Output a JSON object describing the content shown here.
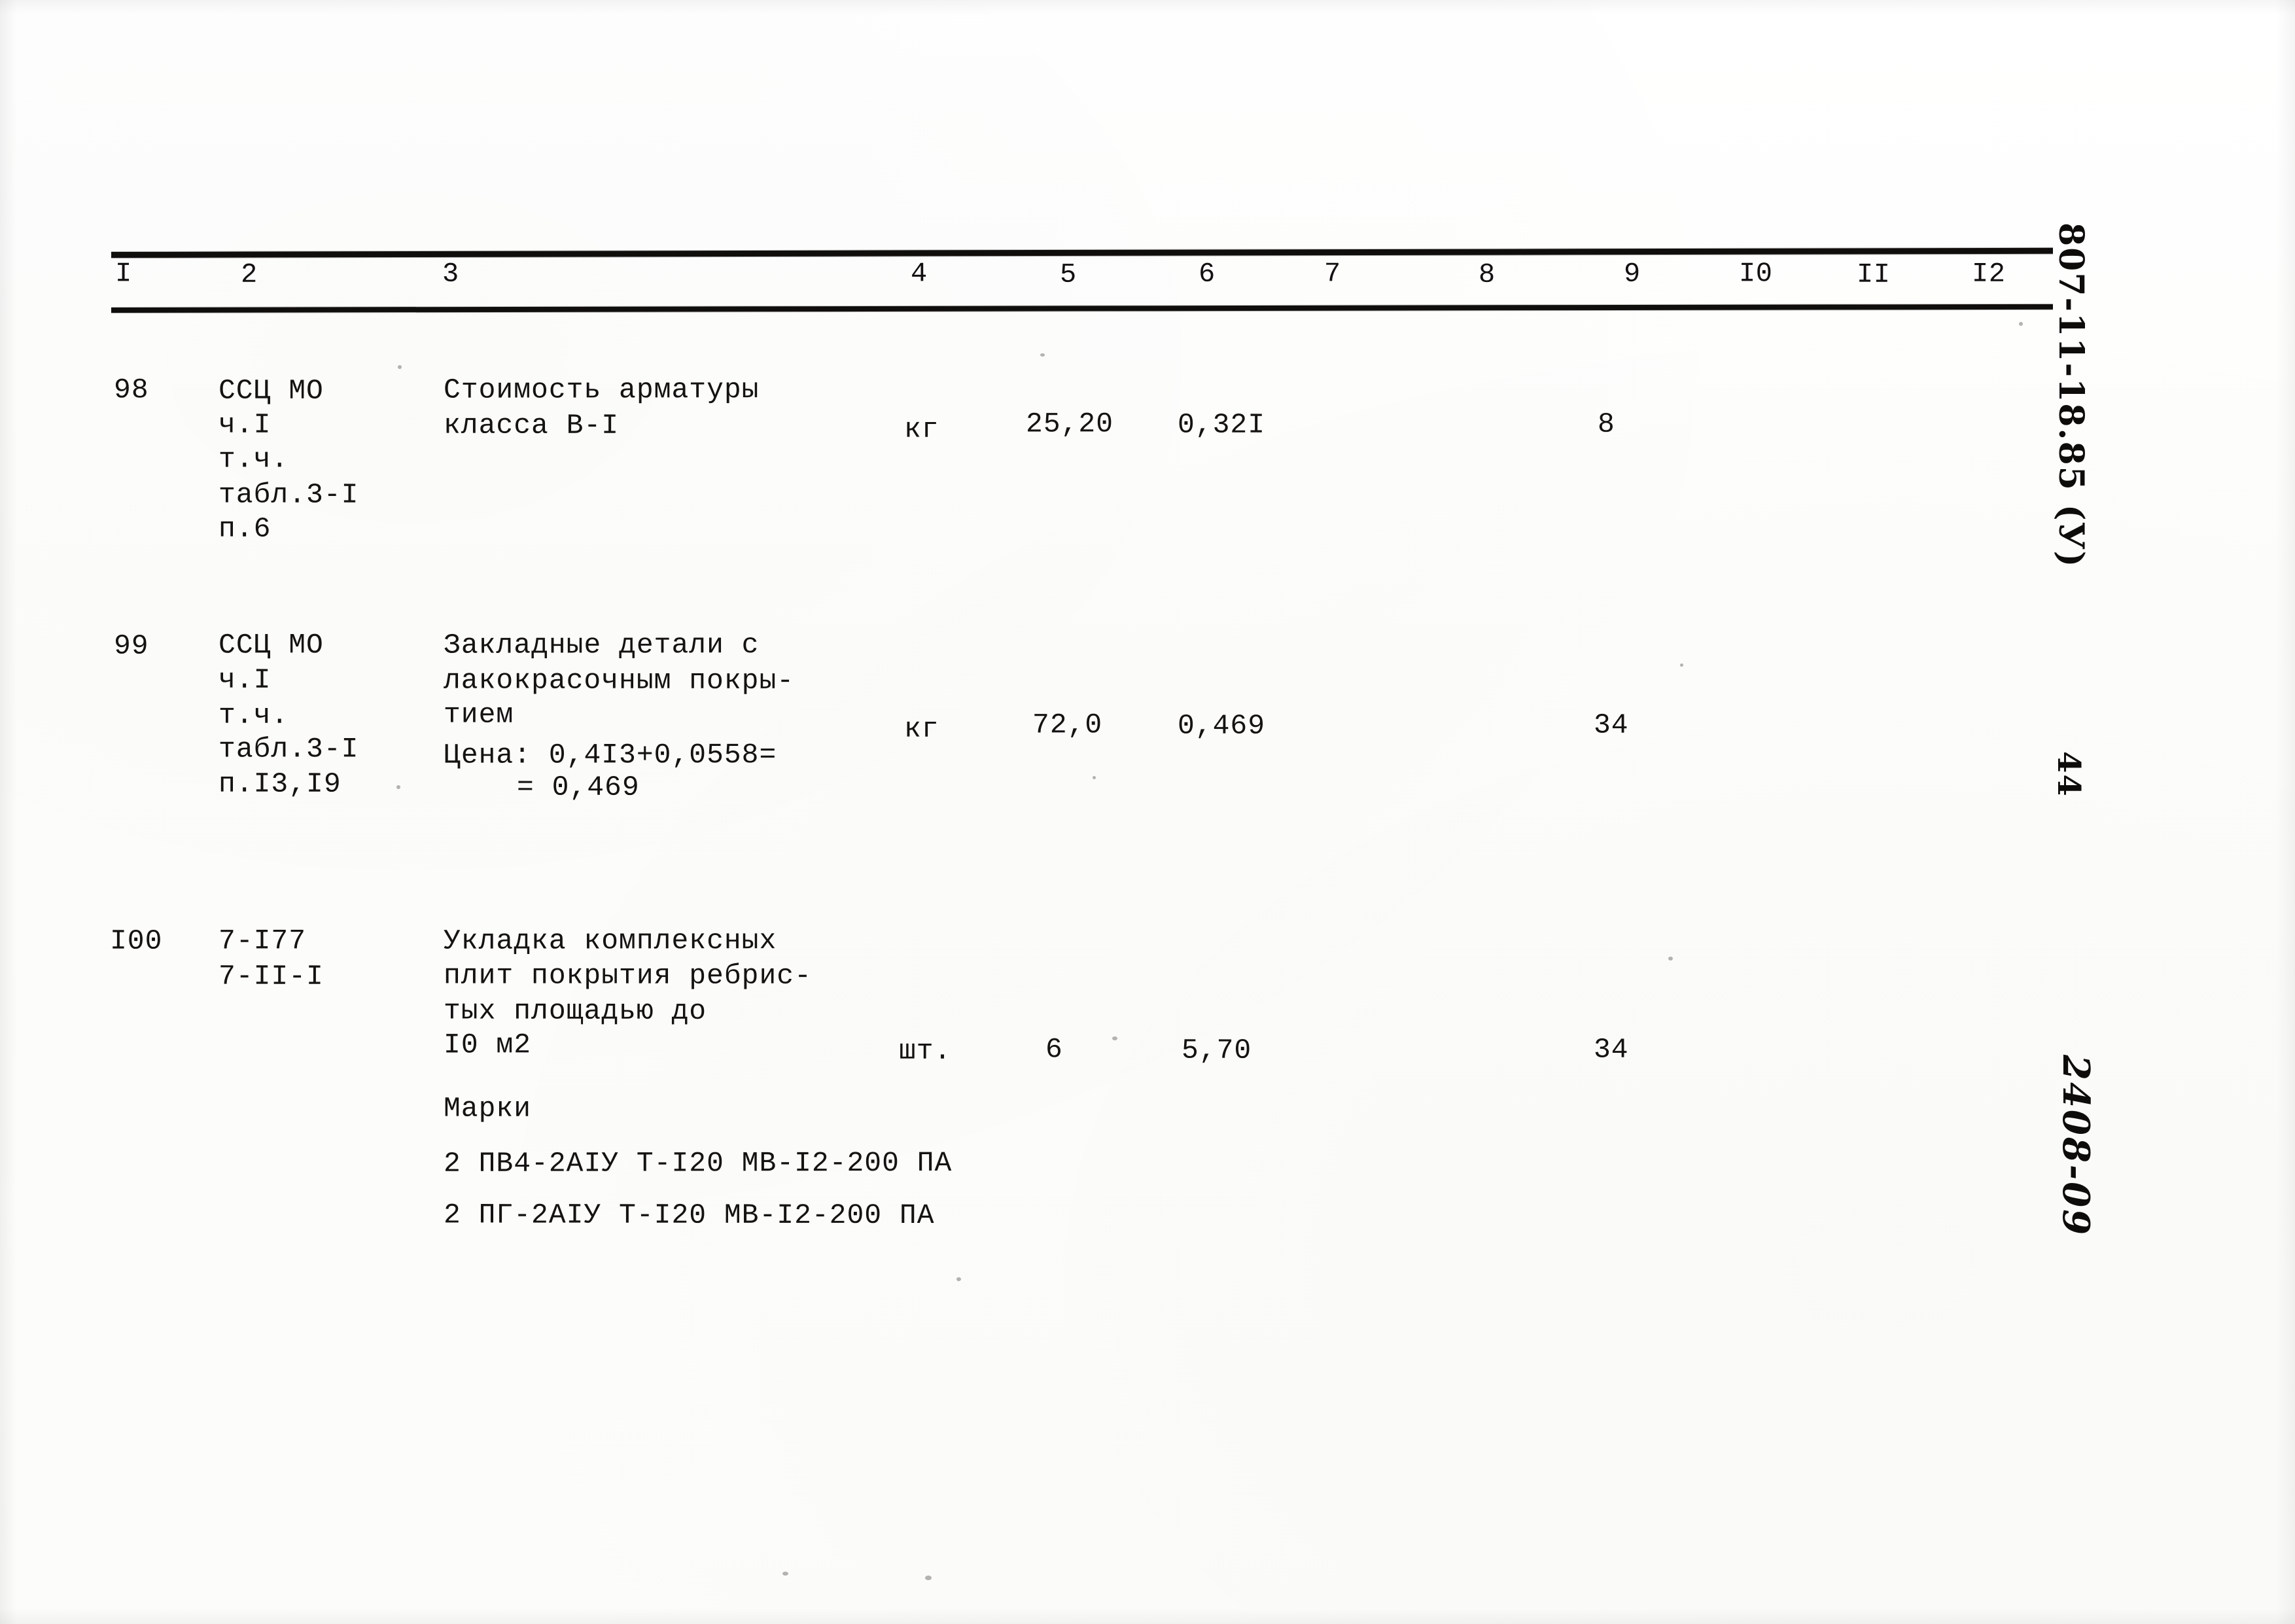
{
  "document": {
    "type": "estimate-table-page",
    "column_headers": [
      "I",
      "2",
      "3",
      "4",
      "5",
      "6",
      "7",
      "8",
      "9",
      "I0",
      "II",
      "I2"
    ],
    "rows": [
      {
        "no": "98",
        "justification_lines": [
          "ССЦ МО",
          "ч.I",
          "т.ч.",
          "табл.3-I",
          "п.6"
        ],
        "description_lines": [
          "Стоимость арматуры",
          "класса В-I"
        ],
        "unit": "кг",
        "col5": "25,20",
        "col6": "0,32I",
        "col7": "",
        "col8": "",
        "col9": "8",
        "col10": "",
        "col11": "",
        "col12": ""
      },
      {
        "no": "99",
        "justification_lines": [
          "ССЦ МО",
          "ч.I",
          "т.ч.",
          "табл.3-I",
          "п.I3,I9"
        ],
        "description_lines": [
          "Закладные детали с",
          "лакокрасочным покры-",
          "тием"
        ],
        "price_note_line1": "Цена: 0,4I3+0,0558=",
        "price_note_line2": "= 0,469",
        "unit": "кг",
        "col5": "72,0",
        "col6": "0,469",
        "col7": "",
        "col8": "",
        "col9": "34",
        "col10": "",
        "col11": "",
        "col12": ""
      },
      {
        "no": "I00",
        "justification_lines": [
          "7-I77",
          "7-II-I"
        ],
        "description_lines": [
          "Укладка комплексных",
          "плит покрытия ребрис-",
          "тых площадью до",
          "I0 м2"
        ],
        "marks_label": "Марки",
        "marks": [
          "2 ПВ4-2АIУ Т-I20 МВ-I2-200 ПА",
          "2 ПГ-2АIУ Т-I20 МВ-I2-200 ПА"
        ],
        "unit": "шт.",
        "col5": "6",
        "col6": "5,70",
        "col7": "",
        "col8": "",
        "col9": "34",
        "col10": "",
        "col11": "",
        "col12": ""
      }
    ]
  },
  "margin_notes": {
    "document_code": "807-11-18.85 (У)",
    "page_number": "44",
    "archive_code": "2408-09"
  }
}
